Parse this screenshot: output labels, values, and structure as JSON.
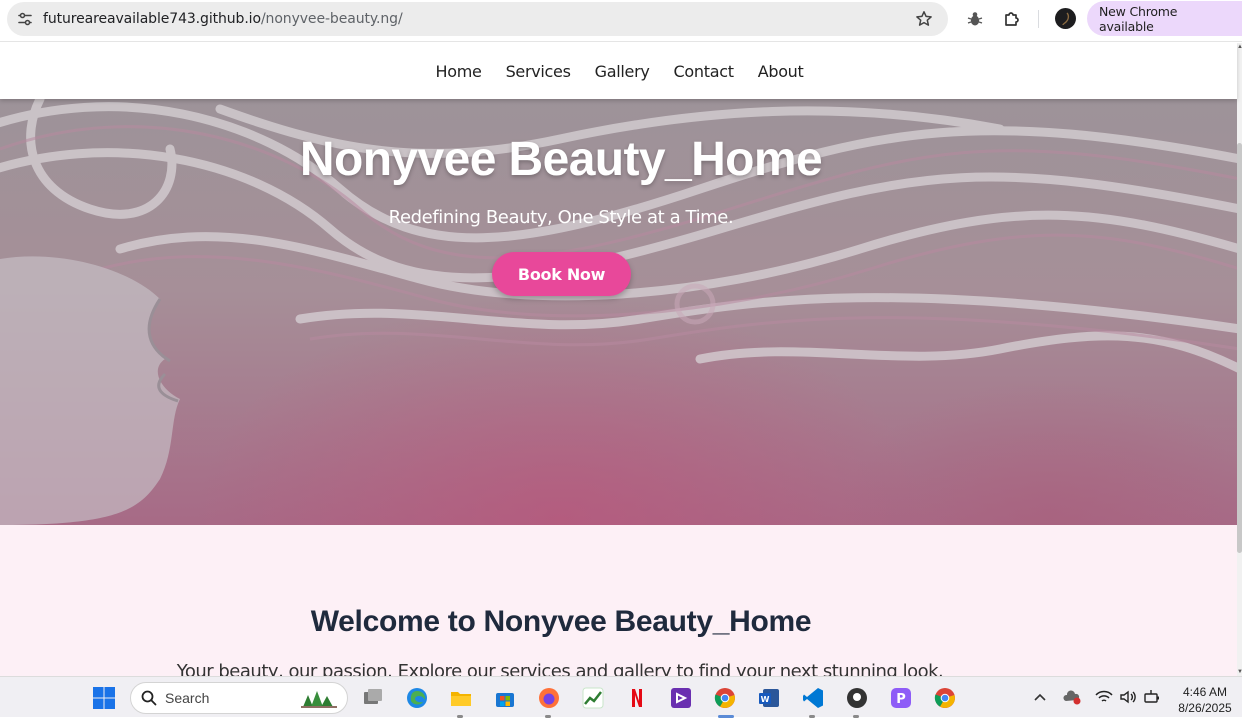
{
  "browser": {
    "url_host": "futureareavailable743.github.io",
    "url_path": "/nonyvee-beauty.ng/",
    "update_chip": "New Chrome available"
  },
  "nav": {
    "links": [
      "Home",
      "Services",
      "Gallery",
      "Contact",
      "About"
    ]
  },
  "hero": {
    "title": "Nonyvee Beauty_Home",
    "subtitle": "Redefining Beauty, One Style at a Time.",
    "cta": "Book Now"
  },
  "welcome": {
    "title": "Welcome to Nonyvee Beauty_Home",
    "text": "Your beauty, our passion. Explore our services and gallery to find your next stunning look."
  },
  "taskbar": {
    "search_placeholder": "Search",
    "time": "4:46 AM",
    "date": "8/26/2025"
  },
  "colors": {
    "accent": "#e8489a",
    "welcome_bg": "#fdf0f6",
    "heading": "#1f2a3d"
  },
  "icons": {
    "site_info": "tune-icon",
    "bookmark": "star-icon",
    "extension_bug": "bug-icon",
    "extensions": "puzzle-icon",
    "menu": "kebab-menu-icon",
    "start": "windows-start-icon",
    "search": "search-icon"
  }
}
